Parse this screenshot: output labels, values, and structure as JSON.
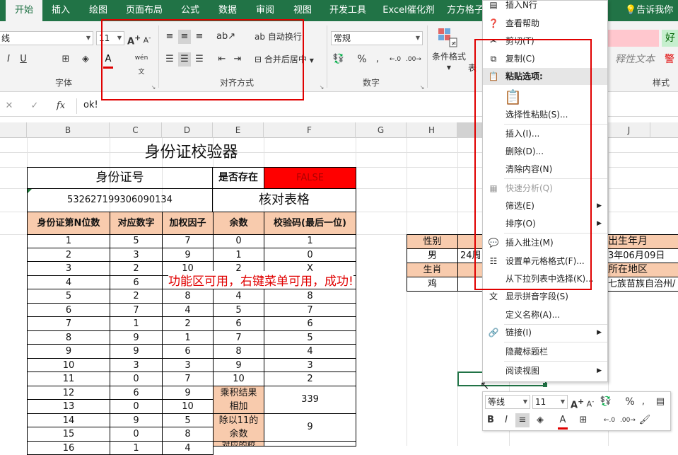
{
  "tabs": [
    "开始",
    "插入",
    "绘图",
    "页面布局",
    "公式",
    "数据",
    "审阅",
    "视图",
    "开发工具",
    "Excel催化剂",
    "方方格子"
  ],
  "tell_me": "告诉我你想",
  "ribbon": {
    "font_name": "线",
    "font_size": "11",
    "font_group": "字体",
    "align_group": "对齐方式",
    "wrap_text": "自动换行",
    "merge_center": "合并后居中",
    "number_group": "数字",
    "number_format": "常规",
    "cond_format": "条件格式",
    "table_cut": "表",
    "styles_group": "样式",
    "style_explain": "释性文本",
    "style_good": "好",
    "style_warn": "警"
  },
  "formula_bar": {
    "fx": "fx",
    "value": "ok!"
  },
  "columns": [
    "B",
    "C",
    "D",
    "E",
    "F",
    "G",
    "H",
    "J"
  ],
  "sheet": {
    "title": "身份证校验器",
    "id_label": "身份证号",
    "exists_label": "是否存在",
    "exists_value": "FALSE",
    "id_number": "532627199306090134",
    "check_table": "核对表格",
    "headers": [
      "身份证第N位数",
      "对应数字",
      "加权因子",
      "余数",
      "校验码(最后一位)"
    ],
    "rows": [
      [
        "1",
        "5",
        "7",
        "0",
        "1"
      ],
      [
        "2",
        "3",
        "9",
        "1",
        "0"
      ],
      [
        "3",
        "2",
        "10",
        "2",
        "X"
      ],
      [
        "4",
        "6",
        "5",
        "3",
        "9"
      ],
      [
        "5",
        "2",
        "8",
        "4",
        "8"
      ],
      [
        "6",
        "7",
        "4",
        "5",
        "7"
      ],
      [
        "7",
        "1",
        "2",
        "6",
        "6"
      ],
      [
        "8",
        "9",
        "1",
        "7",
        "5"
      ],
      [
        "9",
        "9",
        "6",
        "8",
        "4"
      ],
      [
        "10",
        "3",
        "3",
        "9",
        "3"
      ],
      [
        "11",
        "0",
        "7",
        "10",
        "2"
      ],
      [
        "12",
        "6",
        "9"
      ],
      [
        "13",
        "0",
        "10"
      ],
      [
        "14",
        "9",
        "5"
      ],
      [
        "15",
        "0",
        "8"
      ],
      [
        "16",
        "1",
        "4"
      ]
    ],
    "sum_label_1": "乘积结果",
    "sum_label_2": "相加",
    "sum_value": "339",
    "mod_label_1": "除以11的",
    "mod_label_2": "余数",
    "mod_value": "9",
    "partial_label": "对应的校",
    "annotation": "功能区可用，右键菜单可用，成功!",
    "gender_label": "性别",
    "gender_value": "男",
    "age_value": "24周",
    "zodiac_label": "生肖",
    "zodiac_value": "鸡",
    "birth_label": "出生年月",
    "birth_value": "3年06月09日",
    "region_label": "所在地区",
    "region_value": "七族苗族自治州/",
    "active_cell": "ok!"
  },
  "context_menu": {
    "items": [
      {
        "label": "插入N行",
        "icon": "insert-rows-icon",
        "glyph": "▤"
      },
      {
        "label": "查看帮助",
        "icon": "help-icon",
        "glyph": "❓"
      },
      {
        "label": "剪切(T)",
        "icon": "scissors-icon",
        "glyph": "✂"
      },
      {
        "label": "复制(C)",
        "icon": "copy-icon",
        "glyph": "⧉"
      },
      {
        "label": "粘贴选项:",
        "icon": "paste-icon",
        "glyph": "📋"
      },
      {
        "label": "选择性粘贴(S)...",
        "icon": "",
        "glyph": ""
      },
      {
        "label": "插入(I)...",
        "icon": "",
        "glyph": ""
      },
      {
        "label": "删除(D)...",
        "icon": "",
        "glyph": ""
      },
      {
        "label": "清除内容(N)",
        "icon": "",
        "glyph": ""
      },
      {
        "label": "快速分析(Q)",
        "icon": "quick-analysis-icon",
        "glyph": "▦"
      },
      {
        "label": "筛选(E)",
        "icon": "",
        "glyph": ""
      },
      {
        "label": "排序(O)",
        "icon": "",
        "glyph": ""
      },
      {
        "label": "插入批注(M)",
        "icon": "comment-icon",
        "glyph": "💬"
      },
      {
        "label": "设置单元格格式(F)...",
        "icon": "format-cells-icon",
        "glyph": "☷"
      },
      {
        "label": "从下拉列表中选择(K)...",
        "icon": "",
        "glyph": ""
      },
      {
        "label": "显示拼音字段(S)",
        "icon": "phonetic-icon",
        "glyph": "文"
      },
      {
        "label": "定义名称(A)...",
        "icon": "",
        "glyph": ""
      },
      {
        "label": "链接(I)",
        "icon": "link-icon",
        "glyph": "🔗"
      },
      {
        "label": "隐藏标题栏",
        "icon": "",
        "glyph": ""
      },
      {
        "label": "阅读视图",
        "icon": "",
        "glyph": ""
      }
    ]
  },
  "mini_toolbar": {
    "font": "等线",
    "size": "11"
  },
  "colors": {
    "excel_green": "#217346",
    "header_fill": "#f8cbad",
    "false_fill": "#ff0000",
    "annotation": "#e00000"
  }
}
